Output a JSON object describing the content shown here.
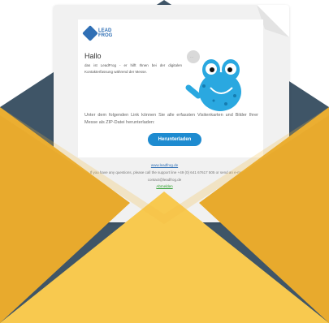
{
  "email": {
    "logo_text": "LEAD FROG",
    "greeting": "Hallo",
    "intro": "das ist LeadFrog - er hilft Ihnen bei der digitalen Kontakterfassung während der Messe.",
    "body": "Unter dem folgenden Link können Sie alle erfassten Visitenkarten und Bilder Ihrer Messe als ZIP-Datei herunterladen:",
    "download_label": "Herunterladen",
    "footer_url": "www.leadfrog.de",
    "footer_support": "If you have any questions, please call the support line +49 (0) 641 67617 505 or send an e-mail to",
    "footer_contact": "contact@leadfrog.de",
    "footer_unsubscribe": "Abmelden"
  },
  "colors": {
    "envelope_back": "#3f5567",
    "envelope_front": "#f4bd40",
    "envelope_flap": "#f8c94f",
    "button": "#1e8bd0",
    "frog": "#2aa8e0"
  }
}
